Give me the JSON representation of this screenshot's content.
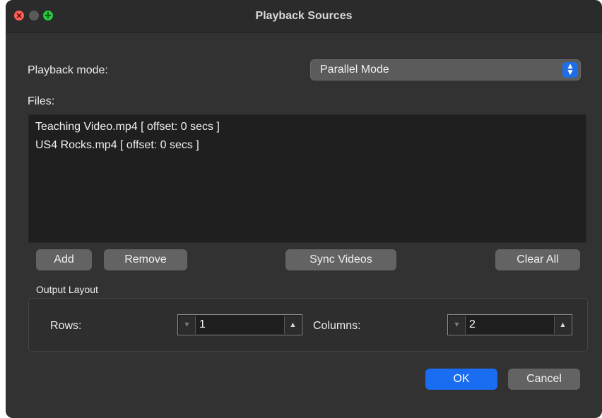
{
  "window": {
    "title": "Playback Sources"
  },
  "playback_mode": {
    "label": "Playback mode:",
    "selected": "Parallel Mode"
  },
  "files": {
    "label": "Files:",
    "items": [
      "Teaching Video.mp4 [ offset: 0 secs ]",
      "US4 Rocks.mp4 [ offset: 0 secs ]"
    ]
  },
  "file_actions": {
    "add": "Add",
    "remove": "Remove",
    "sync": "Sync Videos",
    "clear": "Clear All"
  },
  "output_layout": {
    "label": "Output Layout",
    "rows_label": "Rows:",
    "rows_value": "1",
    "columns_label": "Columns:",
    "columns_value": "2"
  },
  "dialog_buttons": {
    "ok": "OK",
    "cancel": "Cancel"
  },
  "icons": {
    "close": "close-icon",
    "minimize": "minimize-icon",
    "zoom": "zoom-icon",
    "select_arrow": "updown-chevron-icon"
  },
  "colors": {
    "accent": "#1a6cf0",
    "window_bg": "#323232",
    "list_bg": "#1f1f1f"
  }
}
